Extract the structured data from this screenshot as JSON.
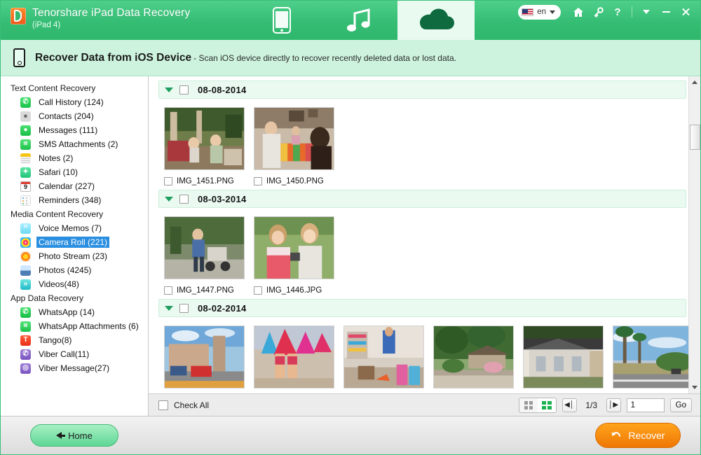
{
  "window": {
    "title": "Tenorshare iPad Data Recovery",
    "device": "(iPad 4)",
    "logo_icon": "tenorshare-logo-icon",
    "language": {
      "code": "en",
      "flag": "us-flag-icon"
    },
    "controls": {
      "home_icon": "home-icon",
      "key_icon": "key-icon",
      "help_icon": "question-mark-icon",
      "more_icon": "chevron-down-icon",
      "minimize_icon": "minimize-icon",
      "close_icon": "close-icon"
    },
    "tabs": [
      {
        "name": "tab-device",
        "icon": "iphone-icon",
        "active": false
      },
      {
        "name": "tab-itunes",
        "icon": "music-note-icon",
        "active": false
      },
      {
        "name": "tab-icloud",
        "icon": "cloud-icon",
        "active": true
      }
    ]
  },
  "subheader": {
    "icon": "mobile-device-icon",
    "title": "Recover Data from iOS Device",
    "description": "- Scan iOS device directly to recover recently deleted data or lost data."
  },
  "sidebar": {
    "groups": [
      {
        "title": "Text Content Recovery",
        "items": [
          {
            "label": "Call History (124)",
            "icon": "phone-icon",
            "icon_class": "ic-call",
            "glyph": "✆",
            "selected": false
          },
          {
            "label": "Contacts (204)",
            "icon": "contacts-icon",
            "icon_class": "ic-contacts",
            "glyph": "●",
            "selected": false
          },
          {
            "label": "Messages (111)",
            "icon": "message-bubble-icon",
            "icon_class": "ic-msg",
            "glyph": "●",
            "selected": false
          },
          {
            "label": "SMS Attachments (2)",
            "icon": "paperclip-icon",
            "icon_class": "ic-sms",
            "glyph": "⌗",
            "selected": false
          },
          {
            "label": "Notes (2)",
            "icon": "notes-icon",
            "icon_class": "ic-notes",
            "glyph": "",
            "selected": false
          },
          {
            "label": "Safari (10)",
            "icon": "compass-icon",
            "icon_class": "ic-safari",
            "glyph": "✦",
            "selected": false
          },
          {
            "label": "Calendar (227)",
            "icon": "calendar-icon",
            "icon_class": "ic-cal",
            "glyph": "9",
            "selected": false
          },
          {
            "label": "Reminders (348)",
            "icon": "reminders-icon",
            "icon_class": "ic-rem",
            "glyph": "",
            "selected": false
          }
        ]
      },
      {
        "title": "Media Content Recovery",
        "items": [
          {
            "label": "Voice Memos (7)",
            "icon": "microphone-icon",
            "icon_class": "ic-voice",
            "glyph": "ᴴ",
            "selected": false
          },
          {
            "label": "Camera Roll (221)",
            "icon": "camera-roll-icon",
            "icon_class": "ic-camroll",
            "glyph": "",
            "selected": true
          },
          {
            "label": "Photo Stream (23)",
            "icon": "photo-stream-icon",
            "icon_class": "ic-stream",
            "glyph": "",
            "selected": false
          },
          {
            "label": "Photos (4245)",
            "icon": "photos-icon",
            "icon_class": "ic-photos",
            "glyph": "",
            "selected": false
          },
          {
            "label": "Videos(48)",
            "icon": "video-icon",
            "icon_class": "ic-videos",
            "glyph": "»",
            "selected": false
          }
        ]
      },
      {
        "title": "App Data Recovery",
        "items": [
          {
            "label": "WhatsApp (14)",
            "icon": "whatsapp-icon",
            "icon_class": "ic-wa",
            "glyph": "✆",
            "selected": false
          },
          {
            "label": "WhatsApp Attachments (6)",
            "icon": "paperclip-icon",
            "icon_class": "ic-waatt",
            "glyph": "⌗",
            "selected": false
          },
          {
            "label": "Tango(8)",
            "icon": "tango-icon",
            "icon_class": "ic-tango",
            "glyph": "T",
            "selected": false
          },
          {
            "label": "Viber Call(11)",
            "icon": "viber-call-icon",
            "icon_class": "ic-viberc",
            "glyph": "✆",
            "selected": false
          },
          {
            "label": "Viber Message(27)",
            "icon": "viber-message-icon",
            "icon_class": "ic-viberm",
            "glyph": "◎",
            "selected": false
          }
        ]
      }
    ]
  },
  "content": {
    "groups": [
      {
        "date": "08-08-2014",
        "collapse_icon": "chevron-down-icon",
        "items": [
          {
            "filename": "IMG_1451.PNG",
            "thumb": "porch-elderly-couple"
          },
          {
            "filename": "IMG_1450.PNG",
            "thumb": "family-dinner-table"
          }
        ]
      },
      {
        "date": "08-03-2014",
        "collapse_icon": "chevron-down-icon",
        "items": [
          {
            "filename": "IMG_1447.PNG",
            "thumb": "man-stroller-sidewalk"
          },
          {
            "filename": "IMG_1446.JPG",
            "thumb": "two-girls-camera"
          }
        ]
      },
      {
        "date": "08-02-2014",
        "collapse_icon": "chevron-down-icon",
        "items": [
          {
            "filename": "",
            "thumb": "town-square-bus"
          },
          {
            "filename": "",
            "thumb": "carnival-dancers"
          },
          {
            "filename": "",
            "thumb": "kids-playroom"
          },
          {
            "filename": "",
            "thumb": "house-trees-wall"
          },
          {
            "filename": "",
            "thumb": "grey-house-roof"
          },
          {
            "filename": "",
            "thumb": "palm-tree-road"
          }
        ]
      }
    ]
  },
  "toolbar": {
    "check_all_label": "Check All",
    "view_grid_icon": "grid-view-icon",
    "view_list_icon": "detail-view-icon",
    "first_page_icon": "first-page-icon",
    "last_page_icon": "last-page-icon",
    "page_info": "1/3",
    "page_input_value": "1",
    "go_label": "Go"
  },
  "footer": {
    "home_label": "Home",
    "home_icon": "arrow-left-icon",
    "recover_label": "Recover",
    "recover_icon": "undo-arrow-icon"
  },
  "colors": {
    "brand_green": "#35bd74",
    "subheader_green": "#cdf3de",
    "selection_blue": "#2a8fe0",
    "recover_orange": "#f58a0b"
  }
}
